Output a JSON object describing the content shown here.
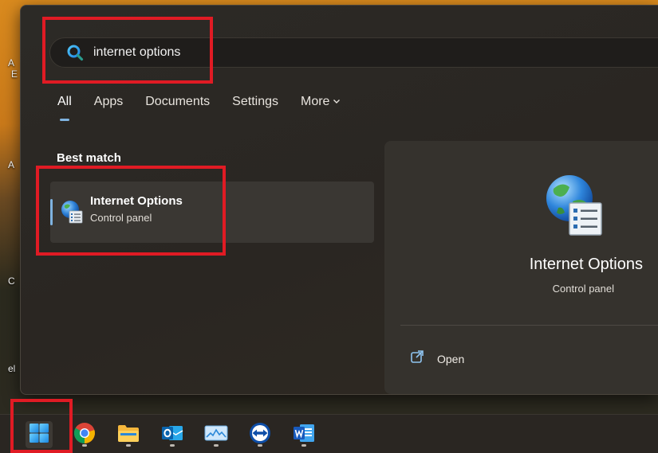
{
  "search": {
    "query": "internet options",
    "icon": "search-icon"
  },
  "tabs": [
    {
      "label": "All",
      "active": true
    },
    {
      "label": "Apps",
      "active": false
    },
    {
      "label": "Documents",
      "active": false
    },
    {
      "label": "Settings",
      "active": false
    },
    {
      "label": "More",
      "active": false
    }
  ],
  "best_match": {
    "heading": "Best match",
    "result": {
      "title": "Internet Options",
      "subtitle": "Control panel",
      "icon": "internet-options-icon"
    }
  },
  "preview": {
    "title": "Internet Options",
    "subtitle": "Control panel",
    "actions": [
      {
        "label": "Open",
        "icon": "open-external-icon"
      }
    ]
  },
  "desktop": {
    "labels": [
      "A",
      "E",
      "A",
      "C",
      "el"
    ]
  },
  "taskbar": {
    "apps": [
      {
        "name": "start-button",
        "icon": "windows-logo-icon"
      },
      {
        "name": "chrome",
        "icon": "chrome-icon"
      },
      {
        "name": "file-explorer",
        "icon": "folder-icon"
      },
      {
        "name": "outlook",
        "icon": "outlook-icon"
      },
      {
        "name": "photos",
        "icon": "photos-icon"
      },
      {
        "name": "teamviewer",
        "icon": "teamviewer-icon"
      },
      {
        "name": "word",
        "icon": "word-icon"
      }
    ]
  },
  "colors": {
    "accent": "#7fb3e0",
    "annotation": "#e01b24",
    "panel": "#2c2a26"
  }
}
